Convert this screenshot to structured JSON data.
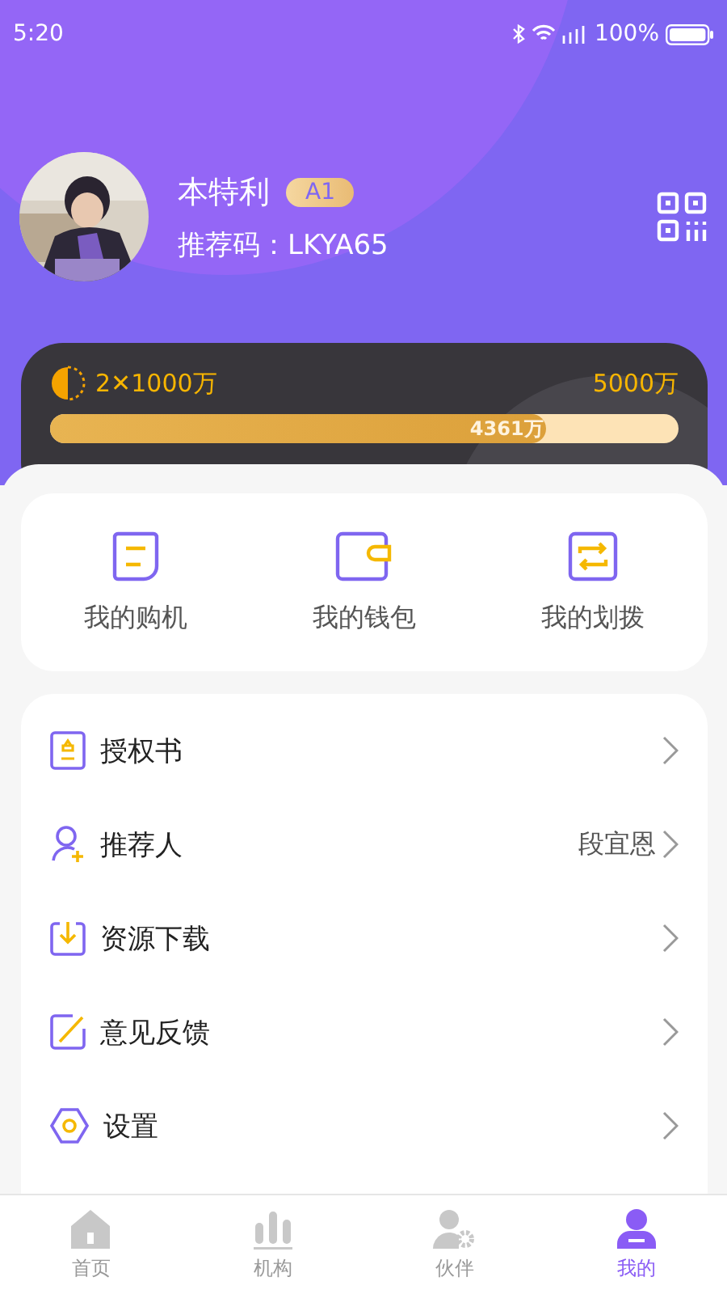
{
  "status_bar": {
    "time": "5:20",
    "battery": "100%"
  },
  "profile": {
    "name": "本特利",
    "level_badge": "A1",
    "referral_code": "推荐码：LKYA65"
  },
  "progress_card": {
    "left_label": "2✕1000万",
    "right_label": "5000万",
    "level": 0.79,
    "reading": "4361万"
  },
  "shortcuts": [
    {
      "kind": "purchase",
      "label": "我的购机"
    },
    {
      "kind": "wallet",
      "label": "我的钱包"
    },
    {
      "kind": "transfer",
      "label": "我的划拨"
    }
  ],
  "menu": [
    {
      "kind": "certificate",
      "label": "授权书"
    },
    {
      "kind": "referrer",
      "label": "推荐人",
      "value": "段宜恩"
    },
    {
      "kind": "download",
      "label": "资源下载"
    },
    {
      "kind": "feedback",
      "label": "意见反馈"
    },
    {
      "kind": "settings",
      "label": "设置"
    }
  ],
  "tab_bar": [
    {
      "kind": "home",
      "label": "首页",
      "selected": false
    },
    {
      "kind": "org",
      "label": "机构",
      "selected": false
    },
    {
      "kind": "partner",
      "label": "伙伴",
      "selected": false
    },
    {
      "kind": "me",
      "label": "我的",
      "selected": true
    }
  ]
}
